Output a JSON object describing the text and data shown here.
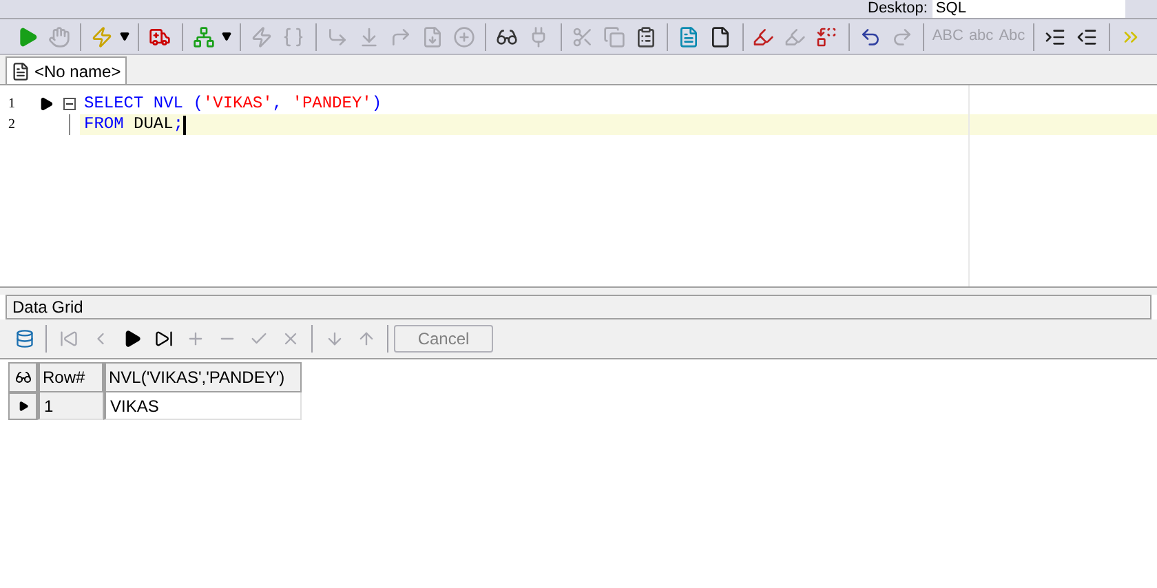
{
  "top_toolbar": {
    "desktop_label": "Desktop:",
    "desktop_value": "SQL"
  },
  "toolbar": [
    {
      "kind": "run",
      "disabled": false
    },
    {
      "kind": "stop",
      "disabled": true
    },
    {
      "kind": "sep"
    },
    {
      "kind": "explain",
      "disabled": false,
      "dropdown": true
    },
    {
      "kind": "sep"
    },
    {
      "kind": "ambulance",
      "disabled": false
    },
    {
      "kind": "sep"
    },
    {
      "kind": "tree",
      "disabled": false,
      "dropdown": true
    },
    {
      "kind": "sep"
    },
    {
      "kind": "zap",
      "disabled": true
    },
    {
      "kind": "braces",
      "disabled": true
    },
    {
      "kind": "sep"
    },
    {
      "kind": "step-into",
      "disabled": true
    },
    {
      "kind": "step-over",
      "disabled": true
    },
    {
      "kind": "step-out",
      "disabled": true
    },
    {
      "kind": "run-to",
      "disabled": true
    },
    {
      "kind": "add-watch",
      "disabled": true
    },
    {
      "kind": "sep"
    },
    {
      "kind": "glasses",
      "disabled": false
    },
    {
      "kind": "plug",
      "disabled": true
    },
    {
      "kind": "sep"
    },
    {
      "kind": "cut",
      "disabled": true
    },
    {
      "kind": "copy",
      "disabled": true
    },
    {
      "kind": "paste",
      "disabled": false
    },
    {
      "kind": "sep"
    },
    {
      "kind": "doc",
      "disabled": false
    },
    {
      "kind": "blank",
      "disabled": false
    },
    {
      "kind": "sep"
    },
    {
      "kind": "highlight",
      "disabled": false
    },
    {
      "kind": "highlight2",
      "disabled": true
    },
    {
      "kind": "replace",
      "disabled": false
    },
    {
      "kind": "sep"
    },
    {
      "kind": "undo",
      "disabled": false
    },
    {
      "kind": "redo",
      "disabled": true
    },
    {
      "kind": "sep"
    },
    {
      "kind": "text",
      "label": "ABC",
      "disabled": true
    },
    {
      "kind": "text",
      "label": "abc",
      "disabled": true
    },
    {
      "kind": "text",
      "label": "Abc",
      "disabled": true
    },
    {
      "kind": "sep"
    },
    {
      "kind": "indent",
      "disabled": false
    },
    {
      "kind": "outdent",
      "disabled": false
    },
    {
      "kind": "sep"
    },
    {
      "kind": "more",
      "disabled": false
    }
  ],
  "tabs": [
    {
      "label": "<No name>",
      "selected": true
    }
  ],
  "editor": {
    "lines": [
      {
        "number": "1",
        "current": false,
        "marker": true,
        "fold": true,
        "tokens": [
          {
            "kind": "keyword",
            "text": "SELECT NVL ("
          },
          {
            "kind": "string",
            "text": "'VIKAS'"
          },
          {
            "kind": "keyword",
            "text": ", "
          },
          {
            "kind": "string",
            "text": "'PANDEY'"
          },
          {
            "kind": "keyword",
            "text": ")"
          }
        ]
      },
      {
        "number": "2",
        "current": true,
        "marker": false,
        "fold": false,
        "tokens": [
          {
            "kind": "keyword",
            "text": "FROM"
          },
          {
            "kind": "plain",
            "text": " DUAL"
          },
          {
            "kind": "keyword",
            "text": ";"
          }
        ]
      }
    ]
  },
  "data_grid": {
    "title": "Data Grid",
    "toolbar": [
      {
        "kind": "db",
        "disabled": false
      },
      {
        "kind": "sep"
      },
      {
        "kind": "first",
        "disabled": true
      },
      {
        "kind": "prev",
        "disabled": true
      },
      {
        "kind": "next",
        "disabled": false
      },
      {
        "kind": "last",
        "disabled": false
      },
      {
        "kind": "insert",
        "disabled": true
      },
      {
        "kind": "delete",
        "disabled": true
      },
      {
        "kind": "post",
        "disabled": true
      },
      {
        "kind": "cancel-edit",
        "disabled": true
      },
      {
        "kind": "sep"
      },
      {
        "kind": "download",
        "disabled": true
      },
      {
        "kind": "upload",
        "disabled": true
      },
      {
        "kind": "sep"
      },
      {
        "kind": "button",
        "label": "Cancel",
        "disabled": true
      }
    ],
    "columns": [
      "Row#",
      "NVL('VIKAS','PANDEY')"
    ],
    "rows": [
      {
        "selected": true,
        "cells": [
          "1",
          "VIKAS"
        ]
      }
    ]
  }
}
